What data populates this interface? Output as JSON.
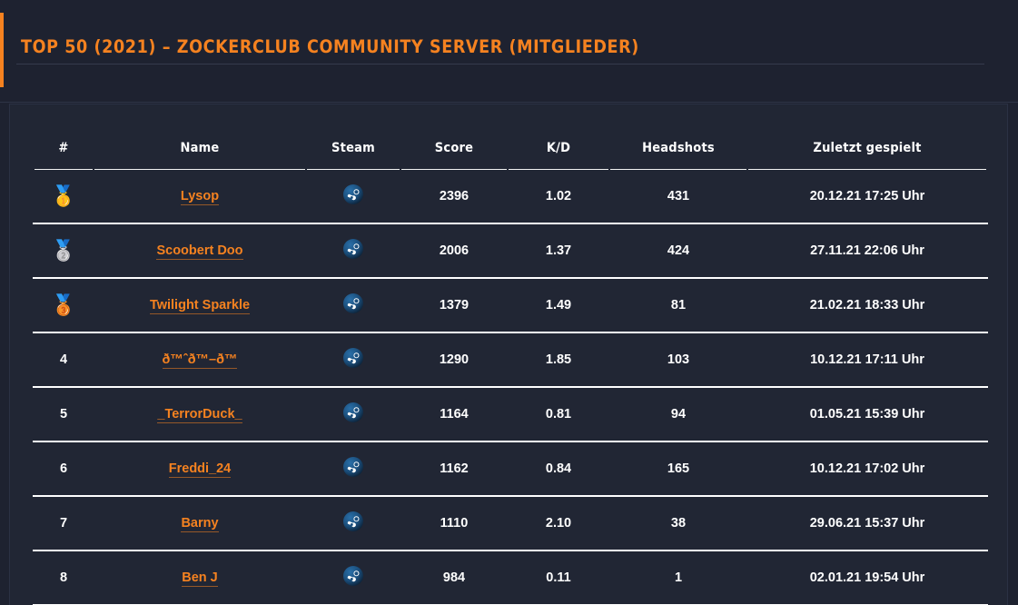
{
  "header": {
    "title": "TOP 50 (2021) – ZOCKERCLUB COMMUNITY SERVER (MITGLIEDER)",
    "accent_color": "#f58220"
  },
  "table": {
    "columns": [
      {
        "key": "rank",
        "label": "#"
      },
      {
        "key": "name",
        "label": "Name"
      },
      {
        "key": "steam",
        "label": "Steam"
      },
      {
        "key": "score",
        "label": "Score"
      },
      {
        "key": "kd",
        "label": "K/D"
      },
      {
        "key": "headshots",
        "label": "Headshots"
      },
      {
        "key": "last_played",
        "label": "Zuletzt gespielt"
      }
    ],
    "rows": [
      {
        "rank": "1",
        "rank_medal": "🥇",
        "name": "Lysop",
        "steam_icon": "steam-icon",
        "score": "2396",
        "kd": "1.02",
        "headshots": "431",
        "last_played": "20.12.21 17:25 Uhr"
      },
      {
        "rank": "2",
        "rank_medal": "🥈",
        "name": "Scoobert Doo",
        "steam_icon": "steam-icon",
        "score": "2006",
        "kd": "1.37",
        "headshots": "424",
        "last_played": "27.11.21 22:06 Uhr"
      },
      {
        "rank": "3",
        "rank_medal": "🥉",
        "name": "Twilight Sparkle",
        "steam_icon": "steam-icon",
        "score": "1379",
        "kd": "1.49",
        "headshots": "81",
        "last_played": "21.02.21 18:33 Uhr"
      },
      {
        "rank": "4",
        "rank_medal": "",
        "name": "ð™ˆð™–ð™",
        "steam_icon": "steam-icon",
        "score": "1290",
        "kd": "1.85",
        "headshots": "103",
        "last_played": "10.12.21 17:11 Uhr"
      },
      {
        "rank": "5",
        "rank_medal": "",
        "name": "_TerrorDuck_",
        "steam_icon": "steam-icon",
        "score": "1164",
        "kd": "0.81",
        "headshots": "94",
        "last_played": "01.05.21 15:39 Uhr"
      },
      {
        "rank": "6",
        "rank_medal": "",
        "name": "Freddi_24",
        "steam_icon": "steam-icon",
        "score": "1162",
        "kd": "0.84",
        "headshots": "165",
        "last_played": "10.12.21 17:02 Uhr"
      },
      {
        "rank": "7",
        "rank_medal": "",
        "name": "Barny",
        "steam_icon": "steam-icon",
        "score": "1110",
        "kd": "2.10",
        "headshots": "38",
        "last_played": "29.06.21 15:37 Uhr"
      },
      {
        "rank": "8",
        "rank_medal": "",
        "name": "Ben J",
        "steam_icon": "steam-icon",
        "score": "984",
        "kd": "0.11",
        "headshots": "1",
        "last_played": "02.01.21 19:54 Uhr"
      }
    ]
  },
  "colors": {
    "page_background": "#1e2230",
    "card_background": "#212634",
    "accent_orange": "#f58220",
    "text_white": "#ffffff",
    "rule_white": "#ffffff"
  }
}
